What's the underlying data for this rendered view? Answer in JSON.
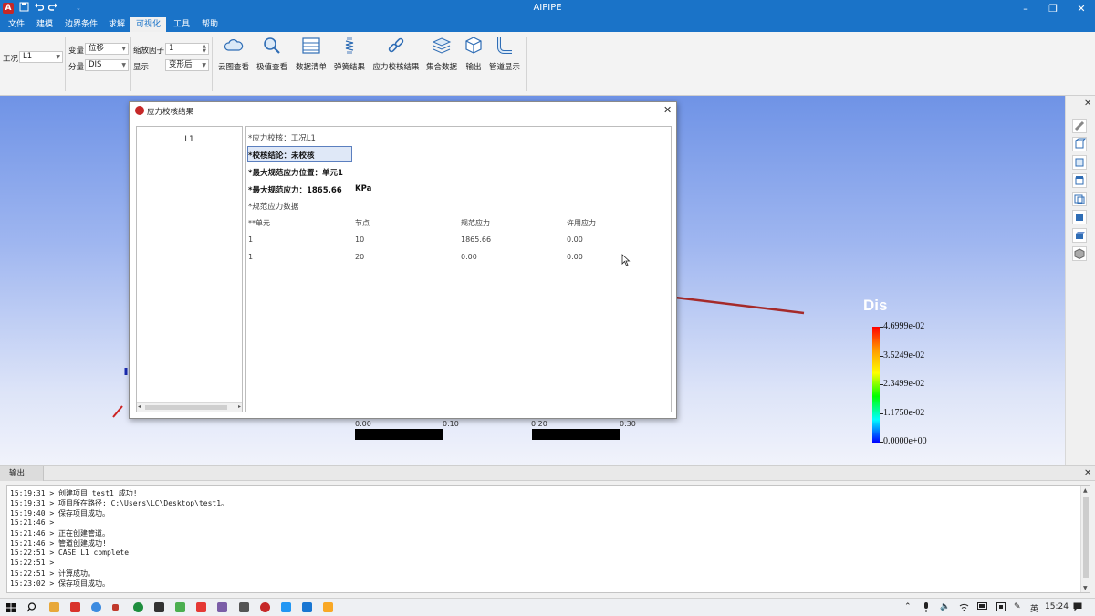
{
  "window": {
    "title": "AIPIPE"
  },
  "menu": [
    "文件",
    "建模",
    "边界条件",
    "求解",
    "可视化",
    "工具",
    "帮助"
  ],
  "ribbon": {
    "case_label": "工况",
    "case_value": "L1",
    "variable_label": "变量",
    "variable_value": "位移",
    "component_label": "分量",
    "component_value": "DIS",
    "scale_label": "缩放因子",
    "scale_value": "1",
    "display_label": "显示",
    "display_value": "变形后",
    "tools": [
      "云图查看",
      "极值查看",
      "数据清单",
      "弹簧结果",
      "应力校核结果",
      "集合数据",
      "输出",
      "管道显示"
    ]
  },
  "dialog": {
    "title": "应力校核结果",
    "case_item": "L1",
    "check_line": "*应力校核：工况L1",
    "conclusion": "*校核结论：未校核",
    "max_location": "*最大规范应力位置：单元1",
    "max_stress_label": "*最大规范应力：1865.66",
    "max_stress_unit": "KPa",
    "data_heading": "*规范应力数据",
    "columns": [
      "**单元",
      "节点",
      "规范应力",
      "许用应力"
    ],
    "rows": [
      [
        "1",
        "10",
        "1865.66",
        "0.00"
      ],
      [
        "1",
        "20",
        "0.00",
        "0.00"
      ]
    ]
  },
  "legend": {
    "title": "Dis",
    "labels": [
      "4.6999e-02",
      "3.5249e-02",
      "2.3499e-02",
      "1.1750e-02",
      "0.0000e+00"
    ]
  },
  "scale_bar": {
    "labels": [
      "0.00",
      "0.10",
      "0.20",
      "0.30"
    ]
  },
  "output": {
    "tab": "输出",
    "lines": [
      "15:19:31 > 创建项目 test1 成功!",
      "15:19:31 > 项目所在路径: C:\\Users\\LC\\Desktop\\test1。",
      "15:19:40 > 保存项目成功。",
      "15:21:46 >",
      "15:21:46 > 正在创建管道。",
      "15:21:46 > 管道创建成功!",
      "15:22:51 > CASE L1 complete",
      "15:22:51 >",
      "15:22:51 > 计算成功。",
      "15:23:02 > 保存项目成功。"
    ]
  },
  "taskbar": {
    "ime": "英",
    "time": "15:24"
  },
  "colors": {
    "accent": "#1a73c8",
    "pipe": "#a52a2a",
    "app_icon": "#c62828"
  }
}
